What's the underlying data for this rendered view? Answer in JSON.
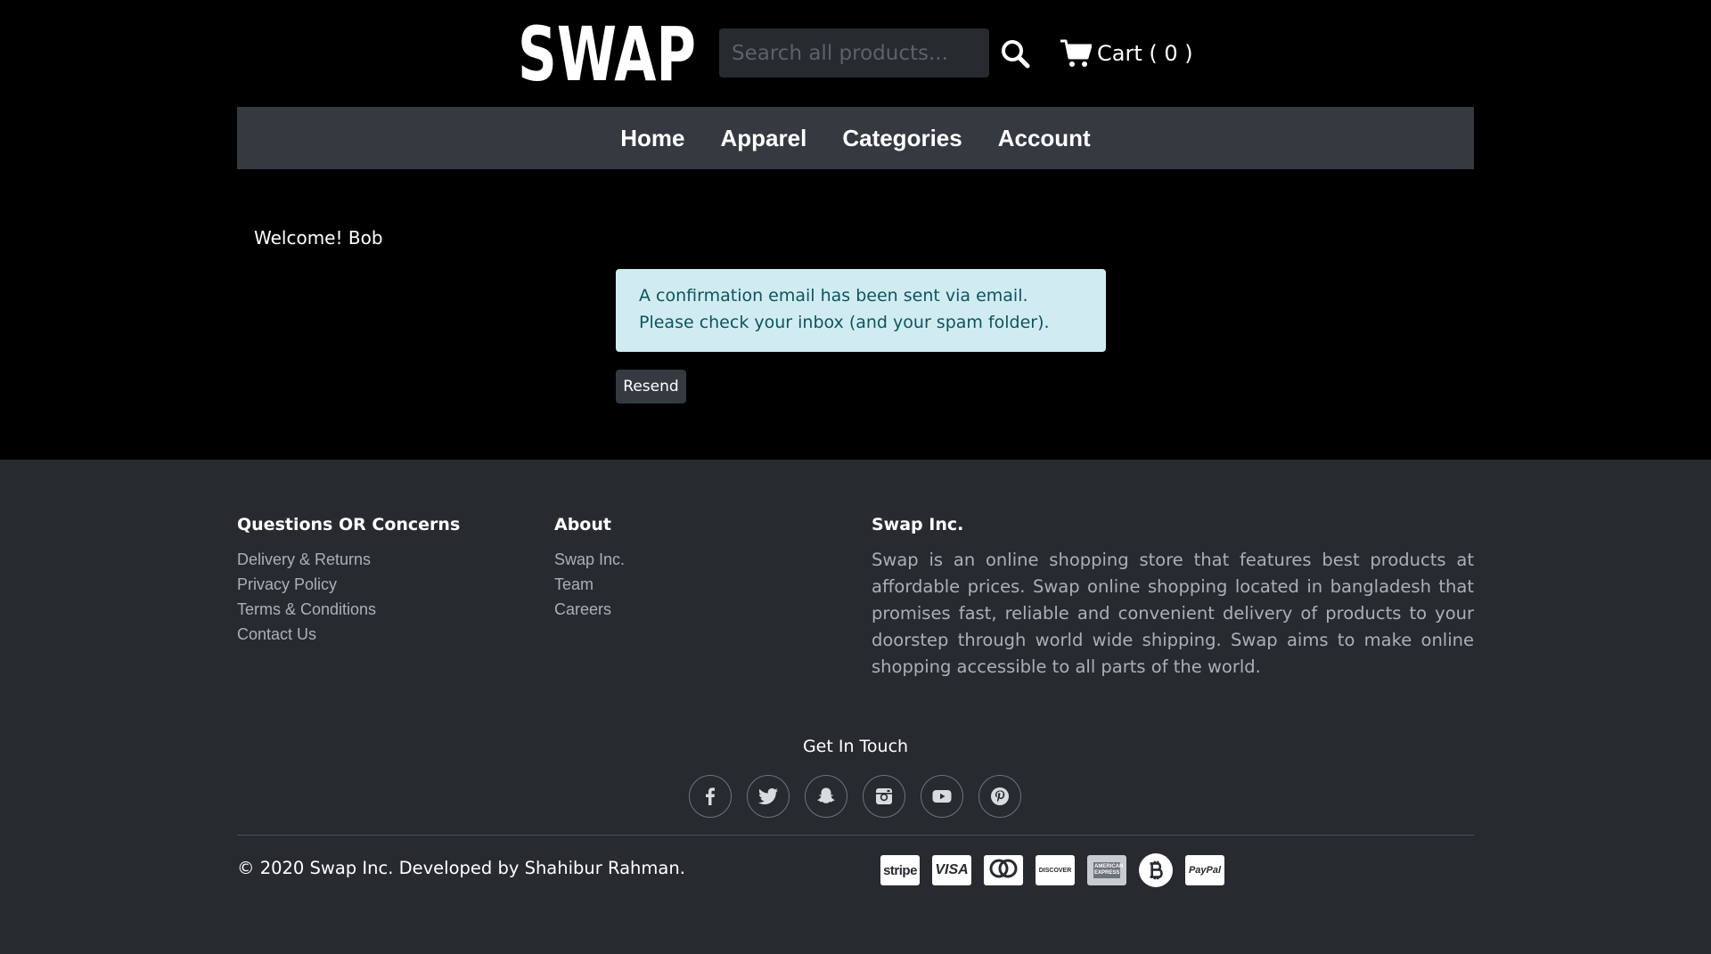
{
  "brand": {
    "logo_text": "SWAP"
  },
  "search": {
    "placeholder": "Search all products..."
  },
  "cart": {
    "label": "Cart ( 0 )"
  },
  "nav": {
    "items": [
      {
        "label": "Home"
      },
      {
        "label": "Apparel"
      },
      {
        "label": "Categories"
      },
      {
        "label": "Account"
      }
    ]
  },
  "main": {
    "welcome": "Welcome! Bob",
    "alert": "A confirmation email has been sent via email. Please check your inbox (and your spam folder).",
    "resend_label": "Resend"
  },
  "footer": {
    "col1": {
      "title": "Questions OR Concerns",
      "links": [
        "Delivery & Returns",
        "Privacy Policy",
        "Terms & Conditions",
        "Contact Us"
      ]
    },
    "col2": {
      "title": "About",
      "links": [
        "Swap Inc.",
        "Team",
        "Careers"
      ]
    },
    "col3": {
      "title": "Swap Inc.",
      "text": "Swap is an online shopping store that features best products at affordable prices. Swap online shopping located in bangladesh that promises fast, reliable and convenient delivery of products to your doorstep through world wide shipping. Swap aims to make online shopping accessible to all parts of the world."
    },
    "get_in_touch": "Get In Touch",
    "socials": [
      "facebook-icon",
      "twitter-icon",
      "snapchat-icon",
      "instagram-icon",
      "youtube-icon",
      "pinterest-icon"
    ],
    "copyright": "© 2020 Swap Inc. Developed by Shahibur Rahman.",
    "payments": {
      "stripe": "stripe",
      "visa": "VISA",
      "discover": "DISCOVER",
      "amex": "AMERICAN EXPRESS",
      "paypal": "PayPal"
    }
  },
  "colors": {
    "page_bg": "#000000",
    "nav_bg": "#343a40",
    "footer_bg": "#272b30",
    "alert_bg": "#d1ecf1",
    "alert_text": "#0c5460"
  }
}
